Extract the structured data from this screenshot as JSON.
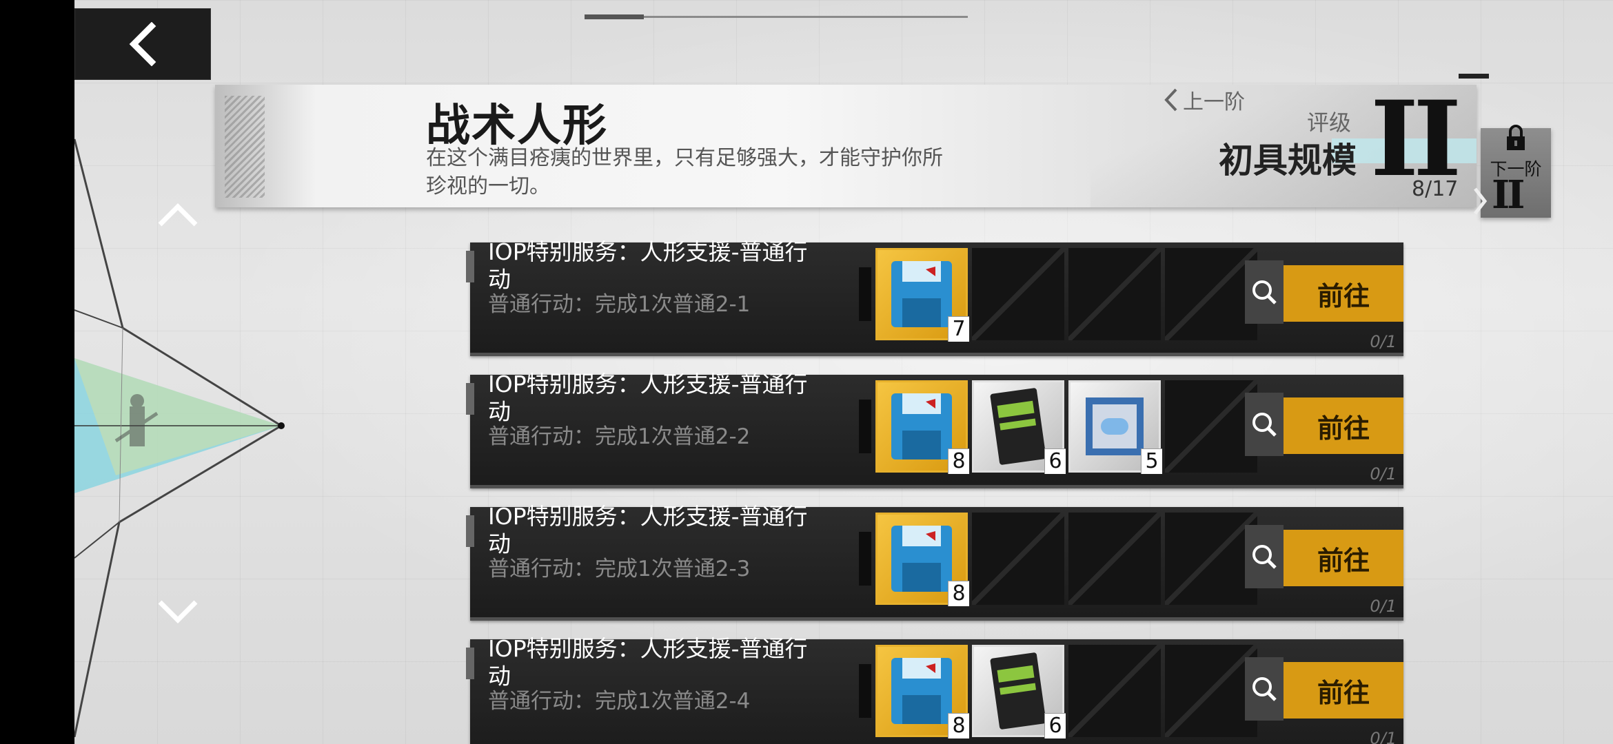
{
  "header": {
    "title": "战术人形",
    "description": "在这个满目疮痍的世界里，只有足够强大，才能守护你所珍视的一切。",
    "prev_tier_label": "上一阶",
    "rating_label": "评级",
    "rating_name": "初具规模",
    "rating_numeral": "II",
    "progress": "8/17"
  },
  "next_tier": {
    "label": "下一阶",
    "numeral": "II",
    "locked": true
  },
  "icons": {
    "back": "back-arrow-icon",
    "up": "chevron-up-icon",
    "down": "chevron-down-icon",
    "lock": "lock-icon",
    "search": "magnifier-icon",
    "floppy": "blue-floppy-disk-icon",
    "ticket": "green-ticket-card-icon",
    "capsule": "blue-capsule-box-icon"
  },
  "tasks": [
    {
      "title": "IOP特别服务：人形支援-普通行动",
      "description": "普通行动：完成1次普通2-1",
      "rewards": [
        {
          "icon": "blue-floppy-disk-icon",
          "count": "7"
        }
      ],
      "go_label": "前往",
      "progress": "0/1"
    },
    {
      "title": "IOP特别服务：人形支援-普通行动",
      "description": "普通行动：完成1次普通2-2",
      "rewards": [
        {
          "icon": "blue-floppy-disk-icon",
          "count": "8"
        },
        {
          "icon": "green-ticket-card-icon",
          "count": "6"
        },
        {
          "icon": "blue-capsule-box-icon",
          "count": "5"
        }
      ],
      "go_label": "前往",
      "progress": "0/1"
    },
    {
      "title": "IOP特别服务：人形支援-普通行动",
      "description": "普通行动：完成1次普通2-3",
      "rewards": [
        {
          "icon": "blue-floppy-disk-icon",
          "count": "8"
        }
      ],
      "go_label": "前往",
      "progress": "0/1"
    },
    {
      "title": "IOP特别服务：人形支援-普通行动",
      "description": "普通行动：完成1次普通2-4",
      "rewards": [
        {
          "icon": "blue-floppy-disk-icon",
          "count": "8"
        },
        {
          "icon": "green-ticket-card-icon",
          "count": "6"
        }
      ],
      "go_label": "前往",
      "progress": "0/1"
    }
  ],
  "colors": {
    "go_button": "#d89a14",
    "row_bg": "#1f1f1f",
    "diagram_cyan": "#7fd3df",
    "diagram_yellow": "#d6e0a0"
  }
}
